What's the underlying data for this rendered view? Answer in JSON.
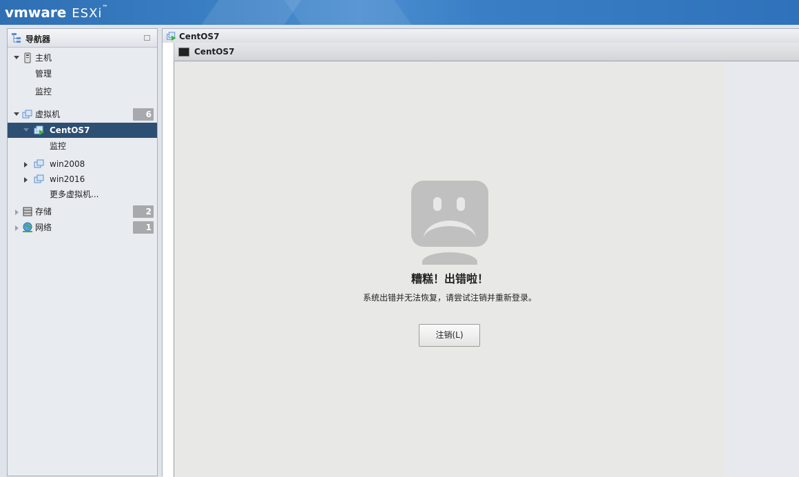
{
  "brand": {
    "vmware": "vmware",
    "product": "ESXi",
    "tm": "™"
  },
  "navigator": {
    "title": "导航器",
    "host": {
      "label": "主机",
      "children": [
        "管理",
        "监控"
      ]
    },
    "vms": {
      "label": "虚拟机",
      "count": "6",
      "selected": "CentOS7",
      "selected_child": "监控",
      "items": [
        "win2008",
        "win2016"
      ],
      "more": "更多虚拟机..."
    },
    "storage": {
      "label": "存储",
      "count": "2"
    },
    "network": {
      "label": "网络",
      "count": "1"
    }
  },
  "main": {
    "tab_title": "CentOS7",
    "console_title": "CentOS7",
    "error": {
      "title": "糟糕！出错啦！",
      "message": "系统出错并无法恢复，请尝试注销并重新登录。",
      "button": "注销(L)"
    }
  }
}
